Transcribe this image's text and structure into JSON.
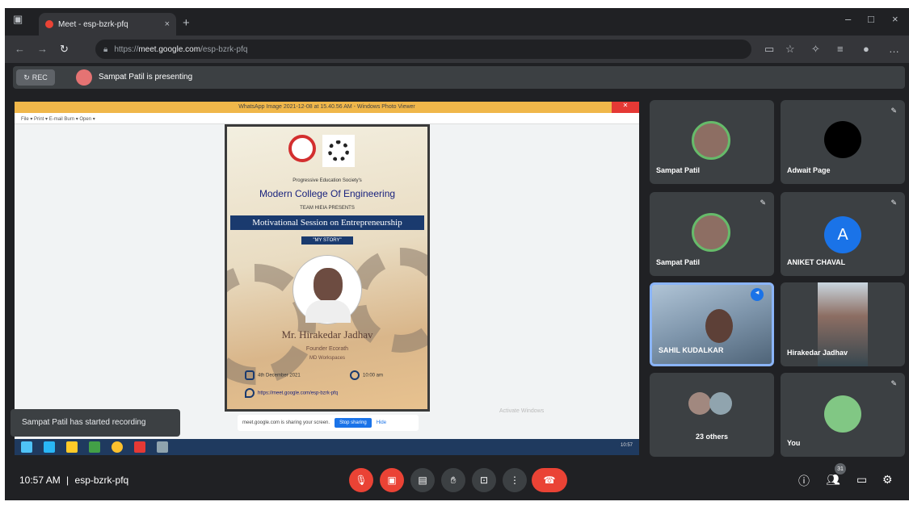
{
  "browser": {
    "tab_title": "Meet - esp-bzrk-pfq",
    "tab_close": "×",
    "new_tab": "+",
    "url_prefix": "https://",
    "url_host": "meet.google.com",
    "url_path": "/esp-bzrk-pfq",
    "win_min": "–",
    "win_max": "□",
    "win_close": "×"
  },
  "presenting": {
    "rec_label": "REC",
    "text": "Sampat Patil is presenting"
  },
  "shared": {
    "viewer_title": "WhatsApp Image 2021-12-08 at 15.40.56 AM - Windows Photo Viewer",
    "viewer_menu": "File ▾   Print ▾   E-mail   Burn ▾   Open ▾",
    "poster": {
      "society": "Progressive Education Society's",
      "college": "Modern College Of Engineering",
      "team": "TEAM HIEIA PRESENTS",
      "session": "Motivational Session on Entrepreneurship",
      "story": "\"MY STORY\"",
      "speaker": "Mr. Hirakedar Jadhav",
      "founder": "Founder Ecorath",
      "director": "MD Workspaces",
      "date": "4th December 2021",
      "time": "10:00 am",
      "url": "https://meet.google.com/esp-bzrk-pfq"
    },
    "watermark": "Activate Windows",
    "share_bar": {
      "text": "meet.google.com is sharing your screen.",
      "stop": "Stop sharing",
      "hide": "Hide"
    },
    "tray_time": "10:57"
  },
  "toast": "Sampat Patil has started recording",
  "participants": [
    {
      "name": "Sampat Patil"
    },
    {
      "name": "Adwait Page"
    },
    {
      "name": "Sampat Patil"
    },
    {
      "name": "ANIKET CHAVAL",
      "initial": "A"
    },
    {
      "name": "SAHIL KUDALKAR"
    },
    {
      "name": "Hirakedar Jadhav"
    },
    {
      "name": "23 others"
    },
    {
      "name": "You"
    }
  ],
  "controls": {
    "time": "10:57 AM",
    "separator": "|",
    "meeting_code": "esp-bzrk-pfq",
    "people_count": "31"
  },
  "colors": {
    "bg": "#202124",
    "tile": "#3c4043",
    "red": "#ea4335",
    "accent": "#1a73e8"
  }
}
